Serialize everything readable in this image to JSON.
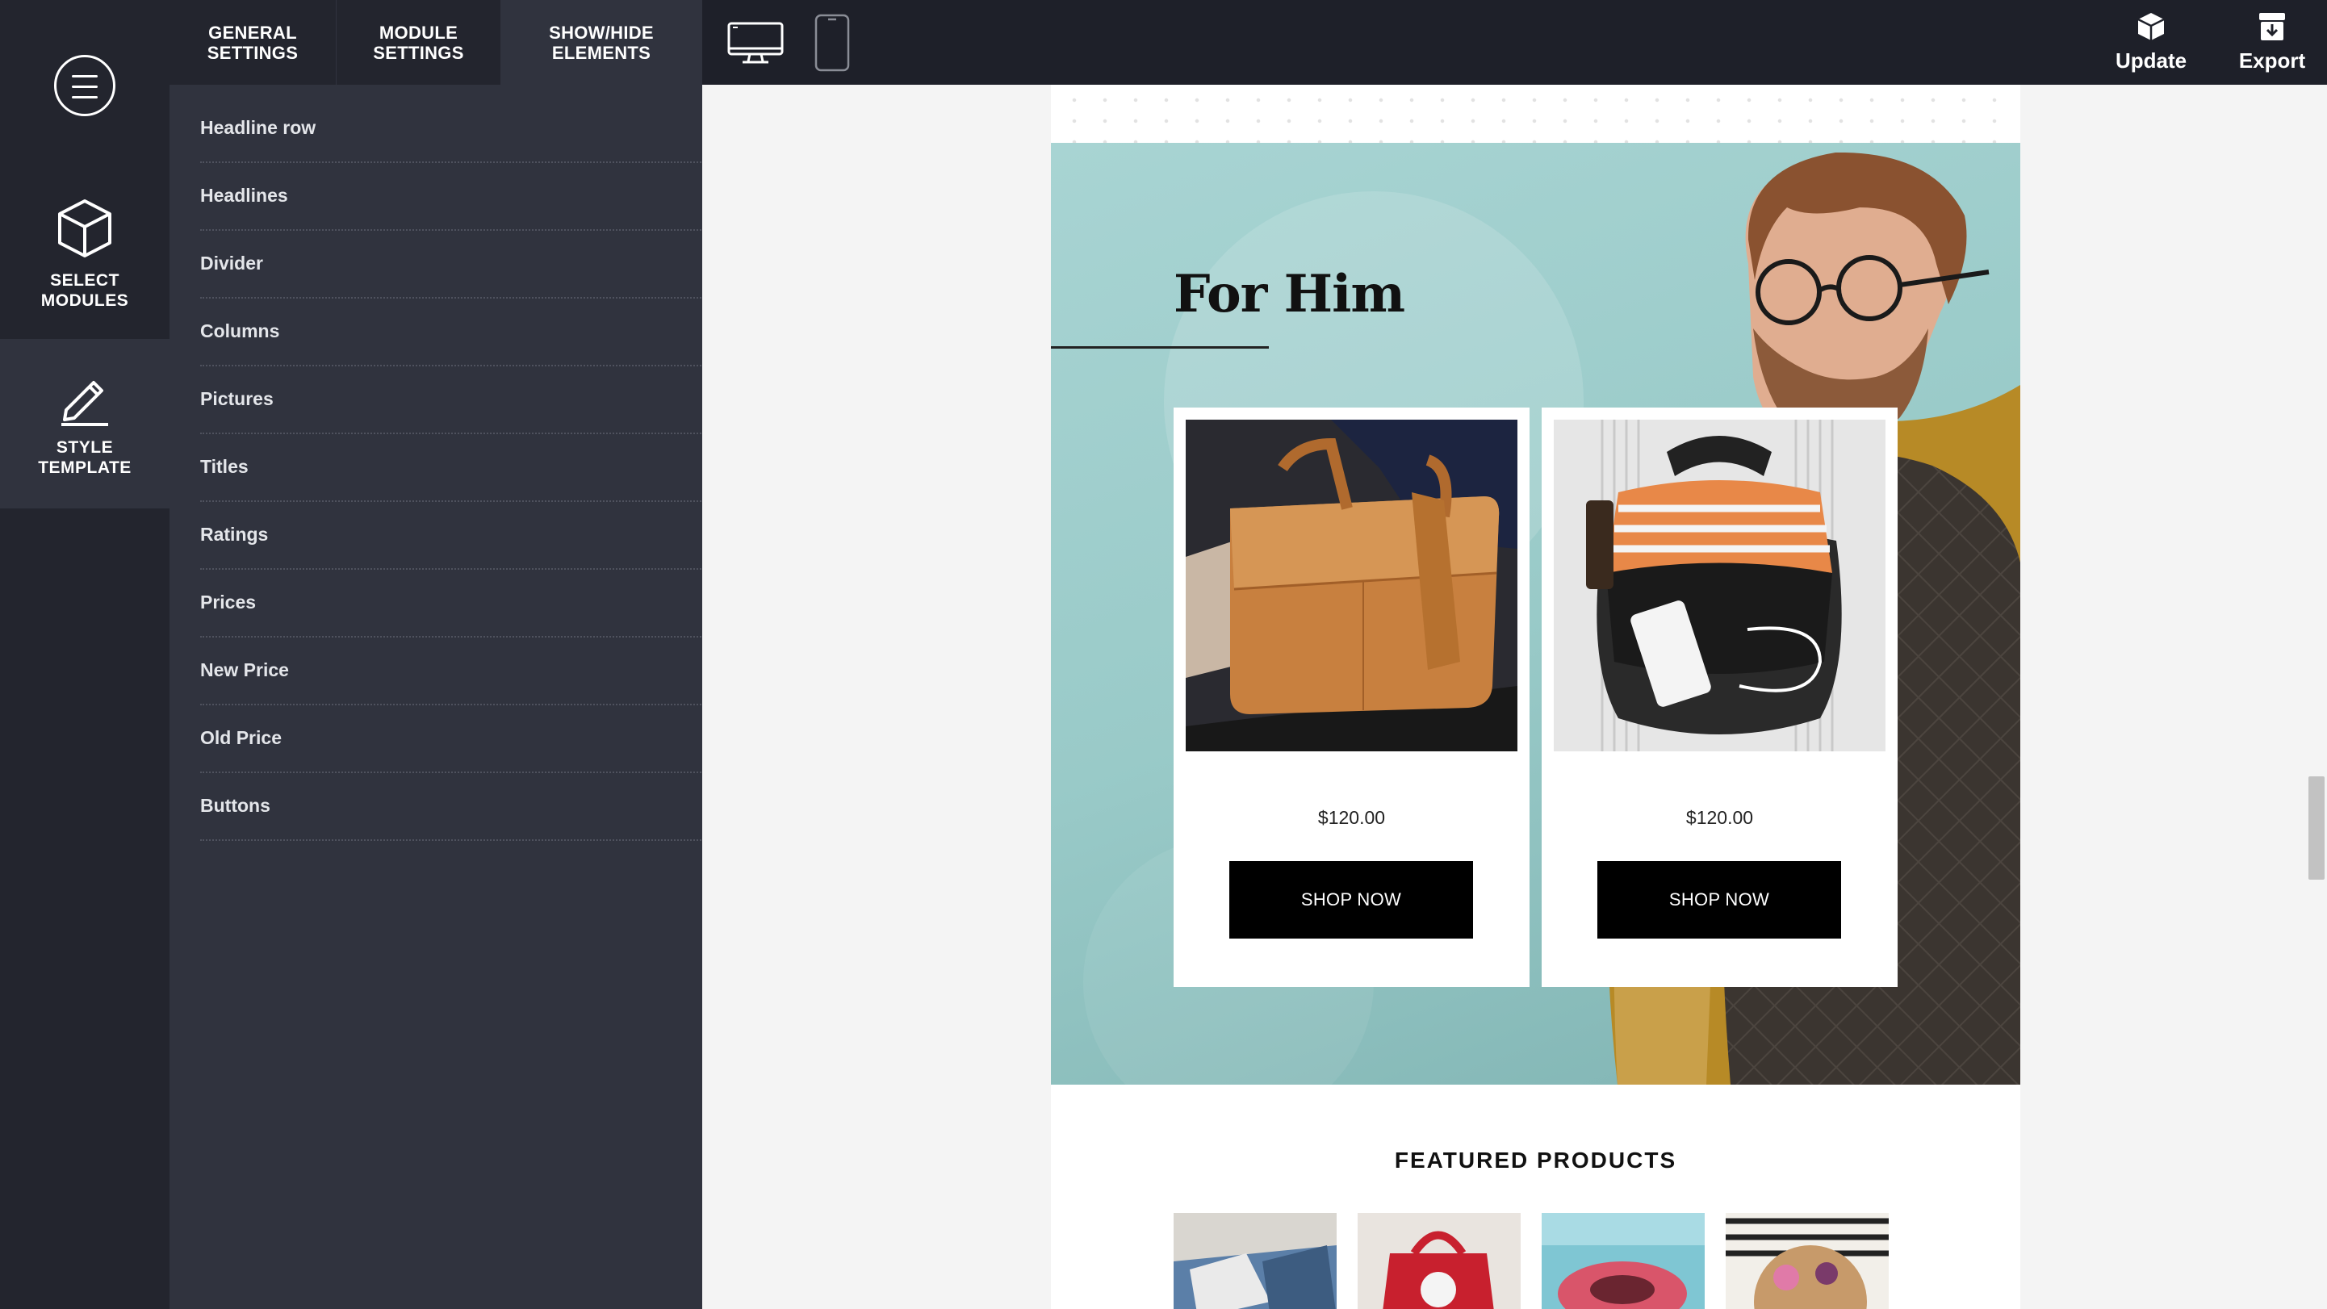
{
  "rail": {
    "menu_icon": "hamburger-menu-icon",
    "items": [
      {
        "label": "SELECT MODULES",
        "icon": "cube-icon",
        "active": false
      },
      {
        "label": "STYLE TEMPLATE",
        "icon": "pencil-icon",
        "active": true
      }
    ]
  },
  "panel": {
    "tabs": [
      {
        "label": "GENERAL SETTINGS",
        "active": false
      },
      {
        "label": "MODULE SETTINGS",
        "active": false
      },
      {
        "label": "SHOW/HIDE ELEMENTS",
        "active": true
      }
    ],
    "elements": [
      {
        "label": "Headline row",
        "visible": true
      },
      {
        "label": "Headlines",
        "visible": true
      },
      {
        "label": "Divider",
        "visible": true
      },
      {
        "label": "Columns",
        "visible": true
      },
      {
        "label": "Pictures",
        "visible": true
      },
      {
        "label": "Titles",
        "visible": false
      },
      {
        "label": "Ratings",
        "visible": false
      },
      {
        "label": "Prices",
        "visible": true
      },
      {
        "label": "New Price",
        "visible": true
      },
      {
        "label": "Old Price",
        "visible": false
      },
      {
        "label": "Buttons",
        "visible": true
      }
    ]
  },
  "topbar": {
    "devices": [
      {
        "icon": "desktop-monitor-icon",
        "selected": true
      },
      {
        "icon": "mobile-phone-icon",
        "selected": false
      }
    ],
    "update_label": "Update",
    "export_label": "Export"
  },
  "email": {
    "hero_title": "For Him",
    "products": [
      {
        "image": "leather-messenger-bag",
        "price": "$120.00",
        "button": "SHOP NOW"
      },
      {
        "image": "black-backpack-with-items",
        "price": "$120.00",
        "button": "SHOP NOW"
      }
    ],
    "featured_title": "FEATURED PRODUCTS",
    "featured_thumbs": [
      "sneakers-photo",
      "red-handbag-photo",
      "pink-hair-scrunchie-photo",
      "woven-straw-bag-photo"
    ]
  },
  "colors": {
    "rail_bg": "#23252e",
    "panel_bg": "#30333e",
    "topbar_bg": "#1e2029",
    "hero_teal": "#9ecfcd",
    "button_black": "#000000"
  }
}
